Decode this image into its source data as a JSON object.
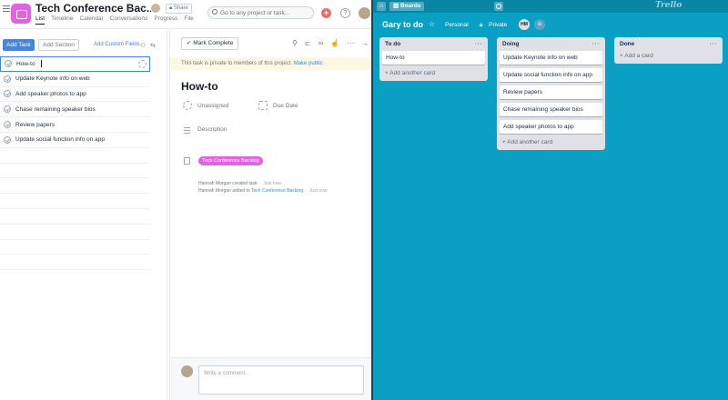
{
  "asana": {
    "project_title": "Tech Conference Bac...",
    "share_label": "Share",
    "tabs": [
      "List",
      "Timeline",
      "Calendar",
      "Conversations",
      "Progress",
      "File"
    ],
    "search_placeholder": "Go to any project or task...",
    "plus_label": "+",
    "help_label": "?",
    "toolbar": {
      "add_task": "Add Task",
      "add_section": "Add Section",
      "add_custom_fields": "Add Custom Fields"
    },
    "tasks": [
      "How-to",
      "Update Keynote info on web",
      "Add speaker photos to app",
      "Chase remaining speaker bios",
      "Review papers",
      "Update social function  info on app"
    ],
    "detail": {
      "mark_complete": "Mark Complete",
      "privacy_text": "This task is private to members of this project.",
      "privacy_link": "Make public",
      "title": "How-to",
      "assignee": "Unassigned",
      "due_date": "Due Date",
      "description_placeholder": "Description",
      "project_tag": "Tech Conference Backlog",
      "activity": [
        {
          "text": "Hannah Morgan created task.",
          "link": "",
          "time": "Just now"
        },
        {
          "text": "Hannah Morgan added to",
          "link": "Tech Conference Backlog.",
          "time": "Just now"
        }
      ],
      "comment_placeholder": "Write a comment..."
    }
  },
  "trello": {
    "boards_label": "Boards",
    "logo": "Trello",
    "board_title": "Gary to do",
    "visibility_personal": "Personal",
    "visibility_private": "Private",
    "member_initials": "HM",
    "lists": [
      {
        "name": "To do",
        "cards": [
          "How-to"
        ],
        "add_label": "+ Add another card"
      },
      {
        "name": "Doing",
        "cards": [
          "Update Keynote info on web",
          "Update social function info on app",
          "Review papers",
          "Chase remaining speaker bios",
          "Add speaker photos to app"
        ],
        "add_label": "+ Add another card"
      },
      {
        "name": "Done",
        "cards": [],
        "add_label": "+ Add a card"
      }
    ]
  },
  "colors": {
    "asana_accent": "#4186e0",
    "asana_project": "#e362e3",
    "trello_bg": "#0aa0c4",
    "trello_header": "#0a86a5"
  }
}
